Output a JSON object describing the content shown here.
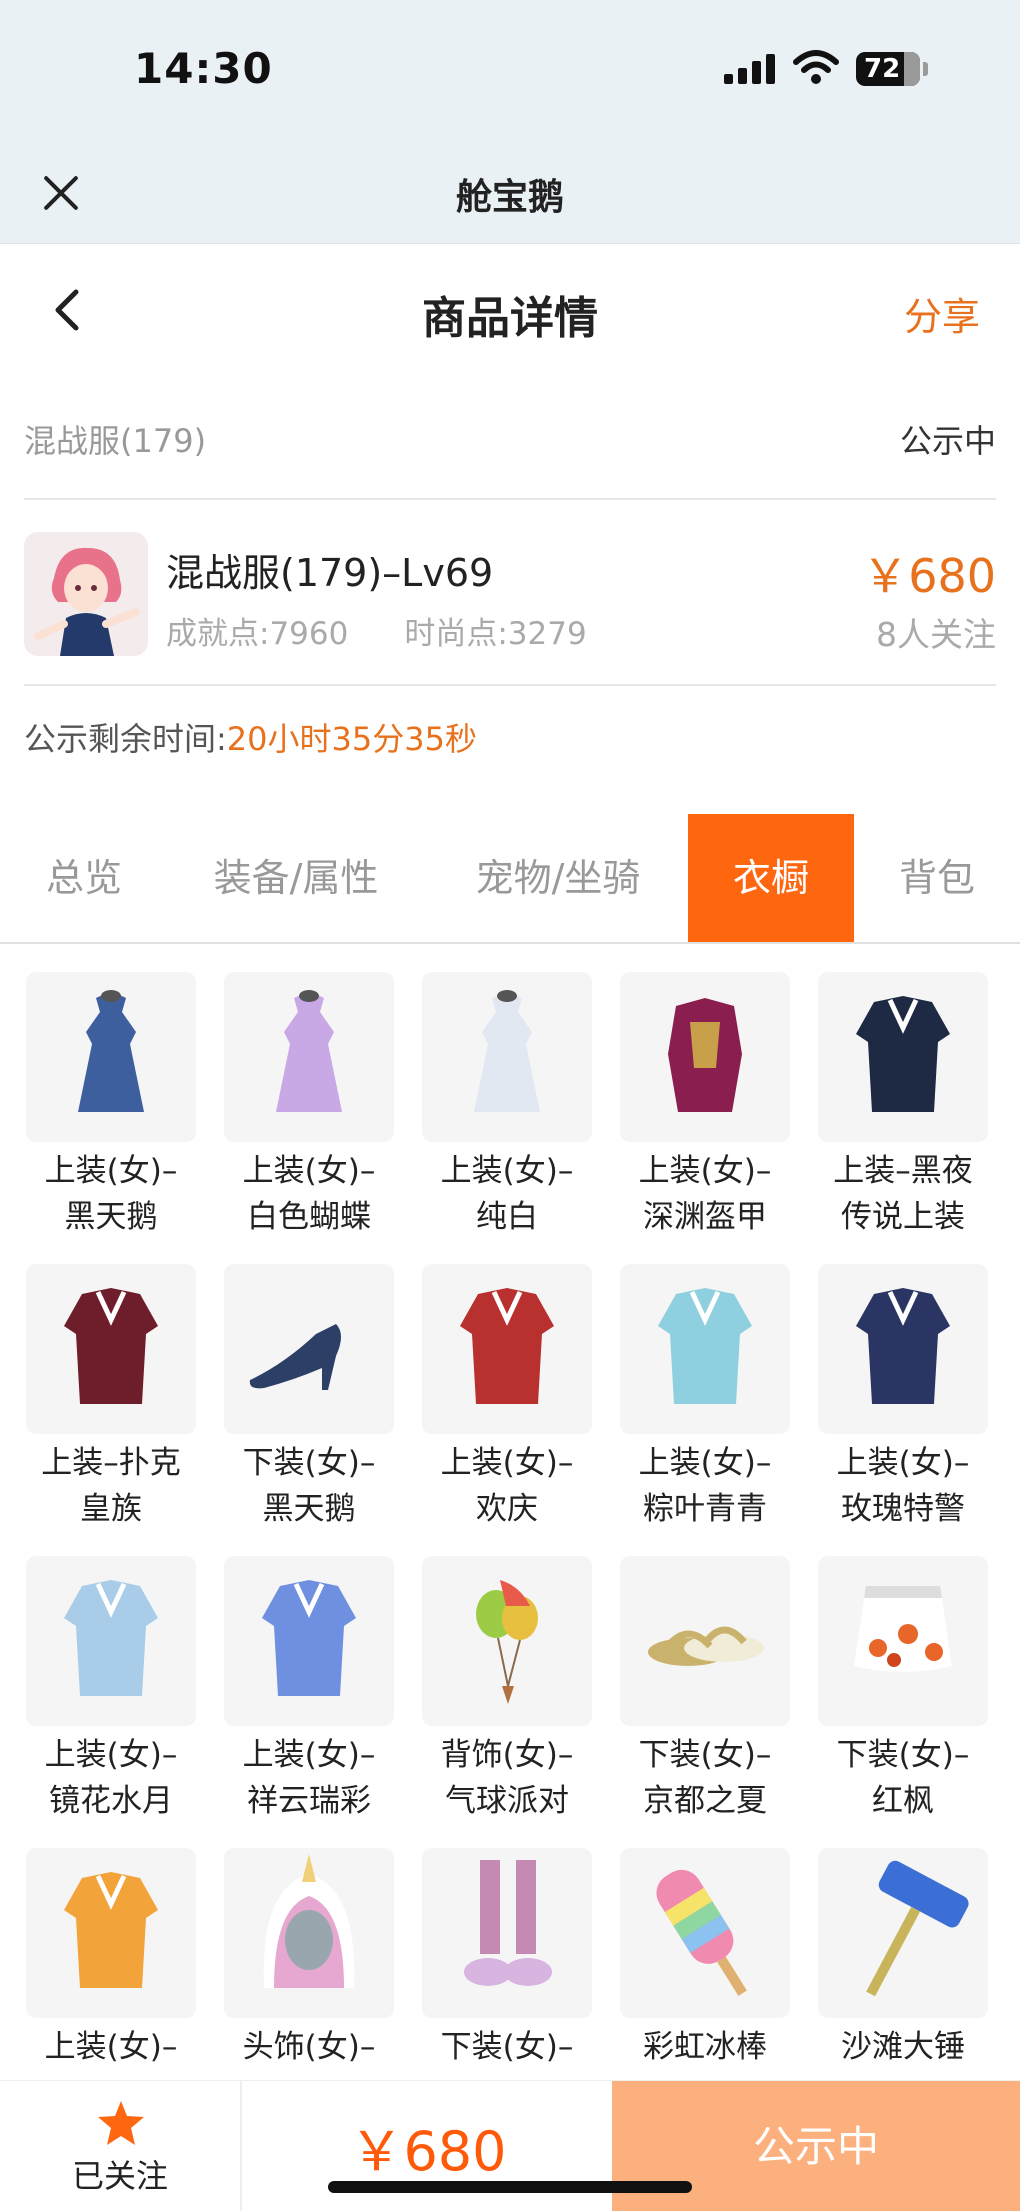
{
  "status_bar": {
    "time": "14:30",
    "battery": "72"
  },
  "mini_app": {
    "title": "舱宝鹅",
    "close_icon": "close-icon"
  },
  "nav": {
    "title": "商品详情",
    "share_label": "分享",
    "back_icon": "chevron-left-icon"
  },
  "server": {
    "name": "混战服(179)",
    "status": "公示中"
  },
  "product": {
    "title": "混战服(179)–Lv69",
    "achievement": "成就点:7960",
    "fashion": "时尚点:3279",
    "price": "￥680",
    "followers": "8人关注"
  },
  "countdown": {
    "label": "公示剩余时间:",
    "value": "20小时35分35秒"
  },
  "tabs": [
    {
      "label": "总览",
      "active": false
    },
    {
      "label": "装备/属性",
      "active": false
    },
    {
      "label": "宠物/坐骑",
      "active": false
    },
    {
      "label": "衣橱",
      "active": true
    },
    {
      "label": "背包",
      "active": false
    }
  ],
  "wardrobe": [
    {
      "line1": "上装(女)–",
      "line2": "黑天鹅",
      "icon": "dress-icon",
      "color": "#3e5f9e"
    },
    {
      "line1": "上装(女)–",
      "line2": "白色蝴蝶",
      "icon": "dress-icon",
      "color": "#c9a8e6"
    },
    {
      "line1": "上装(女)–",
      "line2": "纯白",
      "icon": "dress-icon",
      "color": "#e2e8f2"
    },
    {
      "line1": "上装(女)–",
      "line2": "深渊盔甲",
      "icon": "armor-icon",
      "color": "#8a1f4f"
    },
    {
      "line1": "上装–黑夜",
      "line2": "传说上装",
      "icon": "coat-icon",
      "color": "#1e2a44"
    },
    {
      "line1": "上装–扑克",
      "line2": "皇族",
      "icon": "coat-icon",
      "color": "#6e1d2b"
    },
    {
      "line1": "下装(女)–",
      "line2": "黑天鹅",
      "icon": "heel-icon",
      "color": "#2c3f66"
    },
    {
      "line1": "上装(女)–",
      "line2": "欢庆",
      "icon": "coat-icon",
      "color": "#b8312f"
    },
    {
      "line1": "上装(女)–",
      "line2": "粽叶青青",
      "icon": "coat-icon",
      "color": "#8fd0e0"
    },
    {
      "line1": "上装(女)–",
      "line2": "玫瑰特警",
      "icon": "coat-icon",
      "color": "#2a3563"
    },
    {
      "line1": "上装(女)–",
      "line2": "镜花水月",
      "icon": "coat-icon",
      "color": "#a9cde8"
    },
    {
      "line1": "上装(女)–",
      "line2": "祥云瑞彩",
      "icon": "coat-icon",
      "color": "#6f8fe0"
    },
    {
      "line1": "背饰(女)–",
      "line2": "气球派对",
      "icon": "balloon-icon",
      "color": "#9ccc45"
    },
    {
      "line1": "下装(女)–",
      "line2": "京都之夏",
      "icon": "sandal-icon",
      "color": "#c9b26b"
    },
    {
      "line1": "下装(女)–",
      "line2": "红枫",
      "icon": "skirt-icon",
      "color": "#e8662a"
    },
    {
      "line1": "上装(女)–",
      "line2": "",
      "icon": "coat-icon",
      "color": "#f2a33a"
    },
    {
      "line1": "头饰(女)–",
      "line2": "",
      "icon": "hood-icon",
      "color": "#e6a8d0"
    },
    {
      "line1": "下装(女)–",
      "line2": "",
      "icon": "boot-icon",
      "color": "#c58ab4"
    },
    {
      "line1": "彩虹冰棒",
      "line2": "",
      "icon": "popsicle-icon",
      "color": "#f08ab0"
    },
    {
      "line1": "沙滩大锤",
      "line2": "",
      "icon": "hammer-icon",
      "color": "#3b6fd6"
    }
  ],
  "bottom_bar": {
    "follow_label": "已关注",
    "price": "￥680",
    "status_button": "公示中",
    "accent": "#ff6610"
  }
}
